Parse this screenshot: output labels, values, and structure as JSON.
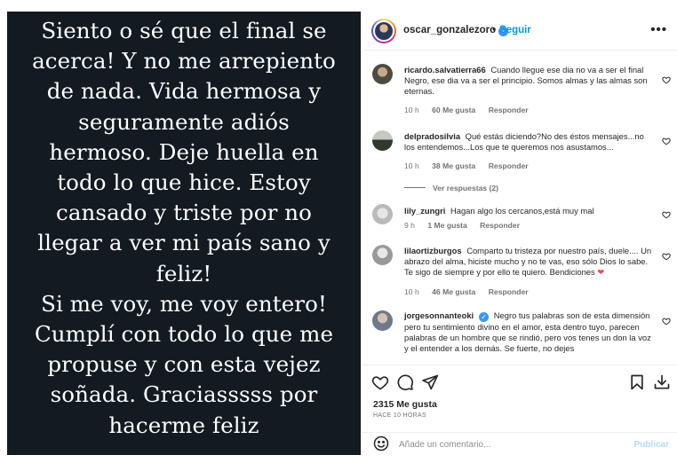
{
  "post_image": {
    "lines": [
      "Siento o sé que el final se",
      "acerca! Y no me arrepiento",
      "de nada. Vida hermosa y",
      "seguramente adiós",
      "hermoso. Deje huella en",
      "todo lo que hice. Estoy",
      "cansado y triste por no",
      "llegar a ver mi país sano y",
      "feliz!",
      "Si me voy, me voy entero!",
      "Cumplí con todo lo que me",
      "propuse y con esta vejez",
      "soñada. Graciasssss por",
      "hacerme feliz"
    ],
    "background": "#141a22"
  },
  "header": {
    "username": "oscar_gonzalezoro",
    "separator": "•",
    "follow_label": "Seguir",
    "more_icon": "more-horizontal-icon"
  },
  "comments": [
    {
      "username": "ricardo.salvatierra66",
      "text": "Cuando llegue ese dia no va a ser el final Negro, ese dia va a ser el principio. Somos almas y las almas son eternas.",
      "time": "10 h",
      "likes": "60 Me gusta",
      "reply": "Responder"
    },
    {
      "username": "delpradosilvia",
      "text": "Qué estás diciendo?No des éstos mensajes...no los entendemos...Los que te queremos nos asustamos...",
      "time": "10 h",
      "likes": "38 Me gusta",
      "reply": "Responder",
      "view_replies": "Ver respuestas (2)"
    },
    {
      "username": "lily_zungri",
      "text": "Hagan algo los cercanos,está muy mal",
      "time": "9 h",
      "likes": "1 Me gusta",
      "reply": "Responder"
    },
    {
      "username": "lilaortizburgos",
      "text": "Comparto tu tristeza por nuestro país, duele.... Un abrazo del alma, hiciste mucho y no te vas, eso sólo Dios lo sabe. Te sigo de siempre y por ello te quiero. Bendiciones",
      "time": "10 h",
      "likes": "46 Me gusta",
      "reply": "Responder"
    },
    {
      "username": "jorgesonnanteoki",
      "text": "Negro tus palabras son de esta dimensión pero tu sentimiento divino en el amor, esta dentro tuyo, parecen palabras de un hombre que se rindió, pero vos tenes un don la voz y el entender a los demás. Se fuerte, no dejes",
      "time": "",
      "likes": "",
      "reply": ""
    }
  ],
  "actions": {
    "likes": "2315 Me gusta",
    "time": "HACE 10 HORAS"
  },
  "add_comment": {
    "placeholder": "Añade un comentario...",
    "publish_label": "Publicar"
  },
  "colors": {
    "accent": "#0095f6",
    "verified": "#3897f0",
    "heart_red": "#ed4956",
    "publish_disabled": "#b3dbff"
  }
}
